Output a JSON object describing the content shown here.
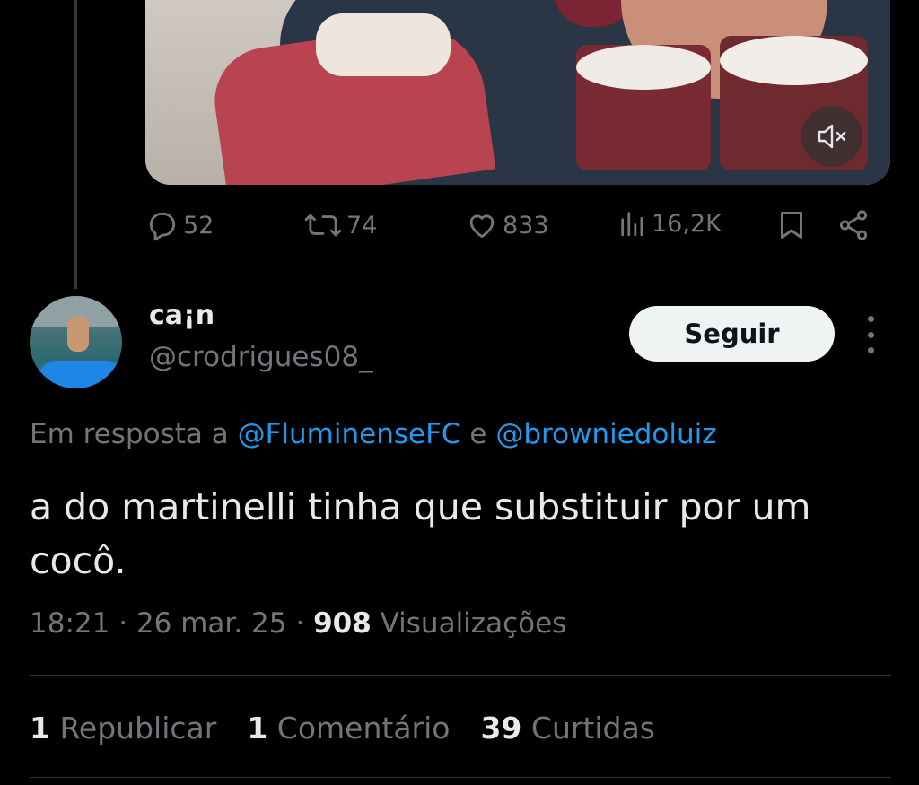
{
  "parent_tweet": {
    "media": {
      "mute_icon": "volume-muted-icon"
    },
    "actions": {
      "replies": "52",
      "reposts": "74",
      "likes": "833",
      "views": "16,2K"
    }
  },
  "reply": {
    "display_name": "ca¡n",
    "handle": "@crodrigues08_",
    "follow_label": "Seguir",
    "replying_prefix": "Em resposta a",
    "mention_1": "@FluminenseFC",
    "mention_joiner": "e",
    "mention_2": "@browniedoluiz",
    "text_line1": "a do martinelli tinha que substituir por um",
    "text_line2": "cocô.",
    "time": "18:21",
    "date": "26 mar. 25",
    "views_count": "908",
    "views_label": "Visualizações",
    "stats": {
      "reposts_count": "1",
      "reposts_label": "Republicar",
      "comments_count": "1",
      "comments_label": "Comentário",
      "likes_count": "39",
      "likes_label": "Curtidas"
    }
  },
  "colors": {
    "background": "#000000",
    "text_primary": "#e7e9ea",
    "text_secondary": "#71767b",
    "link": "#1d9bf0"
  }
}
